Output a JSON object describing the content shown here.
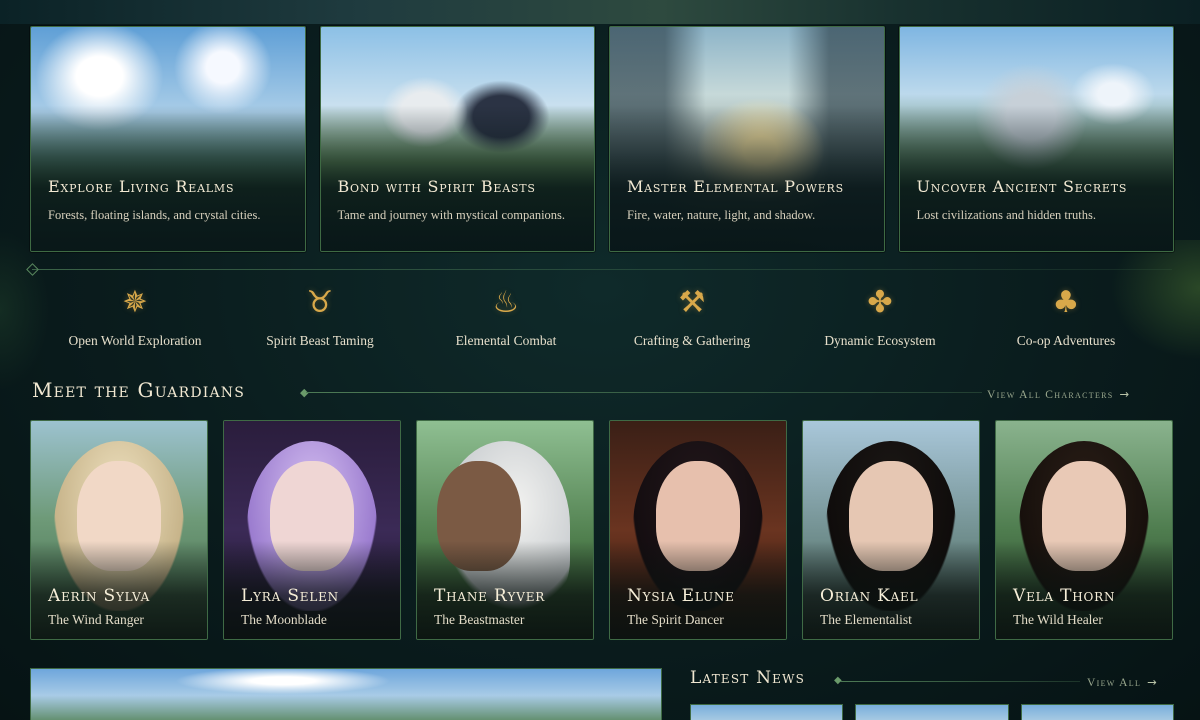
{
  "features": [
    {
      "title": "Explore Living Realms",
      "desc": "Forests, floating islands, and crystal cities."
    },
    {
      "title": "Bond with Spirit Beasts",
      "desc": "Tame and journey with mystical companions."
    },
    {
      "title": "Master Elemental Powers",
      "desc": "Fire, water, nature, light, and shadow."
    },
    {
      "title": "Uncover Ancient Secrets",
      "desc": "Lost civilizations and hidden truths."
    }
  ],
  "gameplay": [
    {
      "label": "Open World Exploration",
      "icon": "compass-icon",
      "glyph": "✵"
    },
    {
      "label": "Spirit Beast Taming",
      "icon": "beast-head-icon",
      "glyph": "♉"
    },
    {
      "label": "Elemental Combat",
      "icon": "flame-icon",
      "glyph": "♨"
    },
    {
      "label": "Crafting & Gathering",
      "icon": "tools-icon",
      "glyph": "⚒"
    },
    {
      "label": "Dynamic Ecosystem",
      "icon": "tree-icon",
      "glyph": "✤"
    },
    {
      "label": "Co-op Adventures",
      "icon": "party-icon",
      "glyph": "♣"
    }
  ],
  "guardians": {
    "title": "Meet the Guardians",
    "view_all": "View All Characters",
    "characters": [
      {
        "name": "Aerin Sylva",
        "role": "The Wind Ranger"
      },
      {
        "name": "Lyra Selen",
        "role": "The Moonblade"
      },
      {
        "name": "Thane Ryver",
        "role": "The Beastmaster"
      },
      {
        "name": "Nysia Elune",
        "role": "The Spirit Dancer"
      },
      {
        "name": "Orian Kael",
        "role": "The Elementalist"
      },
      {
        "name": "Vela Thorn",
        "role": "The Wild Healer"
      }
    ]
  },
  "news": {
    "title": "Latest News",
    "view_all": "View All"
  },
  "colors": {
    "background": "#0a1c1d",
    "accent_gold": "#d8a84a",
    "border_green": "#3e6a43",
    "text_light": "#f1e8d2"
  }
}
